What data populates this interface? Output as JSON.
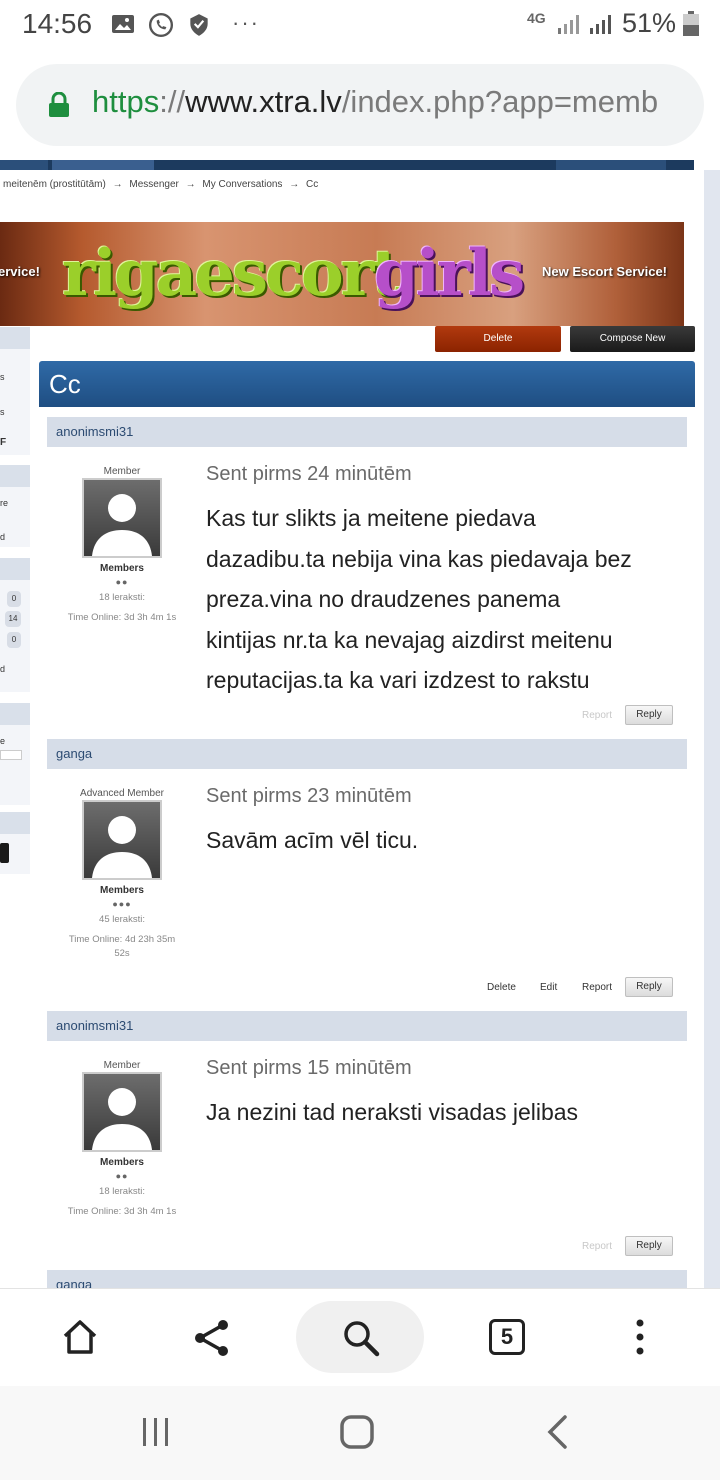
{
  "status_bar": {
    "time": "14:56",
    "network": "4G",
    "battery": "51%"
  },
  "url_bar": {
    "scheme": "https",
    "sep": "://",
    "host": "www.xtra.lv",
    "path": "/index.php?app=memb"
  },
  "breadcrumb": [
    "meitenēm (prostitūtām)",
    "→",
    "Messenger",
    "→",
    "My Conversations",
    "→",
    "Cc"
  ],
  "banner": {
    "logo_part1": "rigaescort",
    "logo_part2": "girls",
    "tag_left": "ervice!",
    "tag_right": "New Escort Service!"
  },
  "sidebar": {
    "texts": [
      "s",
      "s",
      "F",
      "re",
      "d",
      "d",
      "e"
    ],
    "badges": [
      "0",
      "14",
      "0"
    ]
  },
  "actions": {
    "delete": "Delete",
    "compose": "Compose New"
  },
  "conversation": {
    "title": "Cc",
    "posts": [
      {
        "author": "anonimsmi31",
        "role": "Member",
        "group": "Members",
        "pips": "●●",
        "posts_count": "18 leraksti:",
        "time_online": "Time Online: 3d 3h 4m 1s",
        "sent": "Sent pirms 24 minūtēm",
        "message_lines": [
          "Kas tur slikts ja meitene piedava",
          "dazadibu.ta nebija vina kas piedavaja bez",
          "preza.vina no draudzenes panema",
          "kintijas nr.ta ka nevajag aizdirst meitenu",
          "reputacijas.ta ka vari izdzest to rakstu"
        ],
        "report": "Report",
        "reply": "Reply"
      },
      {
        "author": "ganga",
        "role": "Advanced Member",
        "group": "Members",
        "pips": "●●●",
        "posts_count": "45 leraksti:",
        "time_online_1": "Time Online: 4d 23h 35m",
        "time_online_2": "52s",
        "sent": "Sent pirms 23 minūtēm",
        "message_lines": [
          "Savām acīm vēl ticu."
        ],
        "delete": "Delete",
        "edit": "Edit",
        "report": "Report",
        "reply": "Reply"
      },
      {
        "author": "anonimsmi31",
        "role": "Member",
        "group": "Members",
        "pips": "●●",
        "posts_count": "18 leraksti:",
        "time_online": "Time Online: 3d 3h 4m 1s",
        "sent": "Sent pirms 15 minūtēm",
        "message_lines": [
          "Ja nezini tad neraksti visadas jelibas"
        ],
        "report": "Report",
        "reply": "Reply"
      },
      {
        "author": "ganga"
      }
    ]
  },
  "toolbar": {
    "tabs_count": "5",
    "icons": [
      "home-icon",
      "share-icon",
      "search-icon",
      "tabs-icon",
      "more-icon"
    ]
  },
  "nav_bar": {
    "icons": [
      "recents-icon",
      "home-nav-icon",
      "back-icon"
    ]
  },
  "colors": {
    "accent_blue": "#1f4e82",
    "url_green": "#1e8e3e",
    "delete_red": "#a8300a"
  }
}
